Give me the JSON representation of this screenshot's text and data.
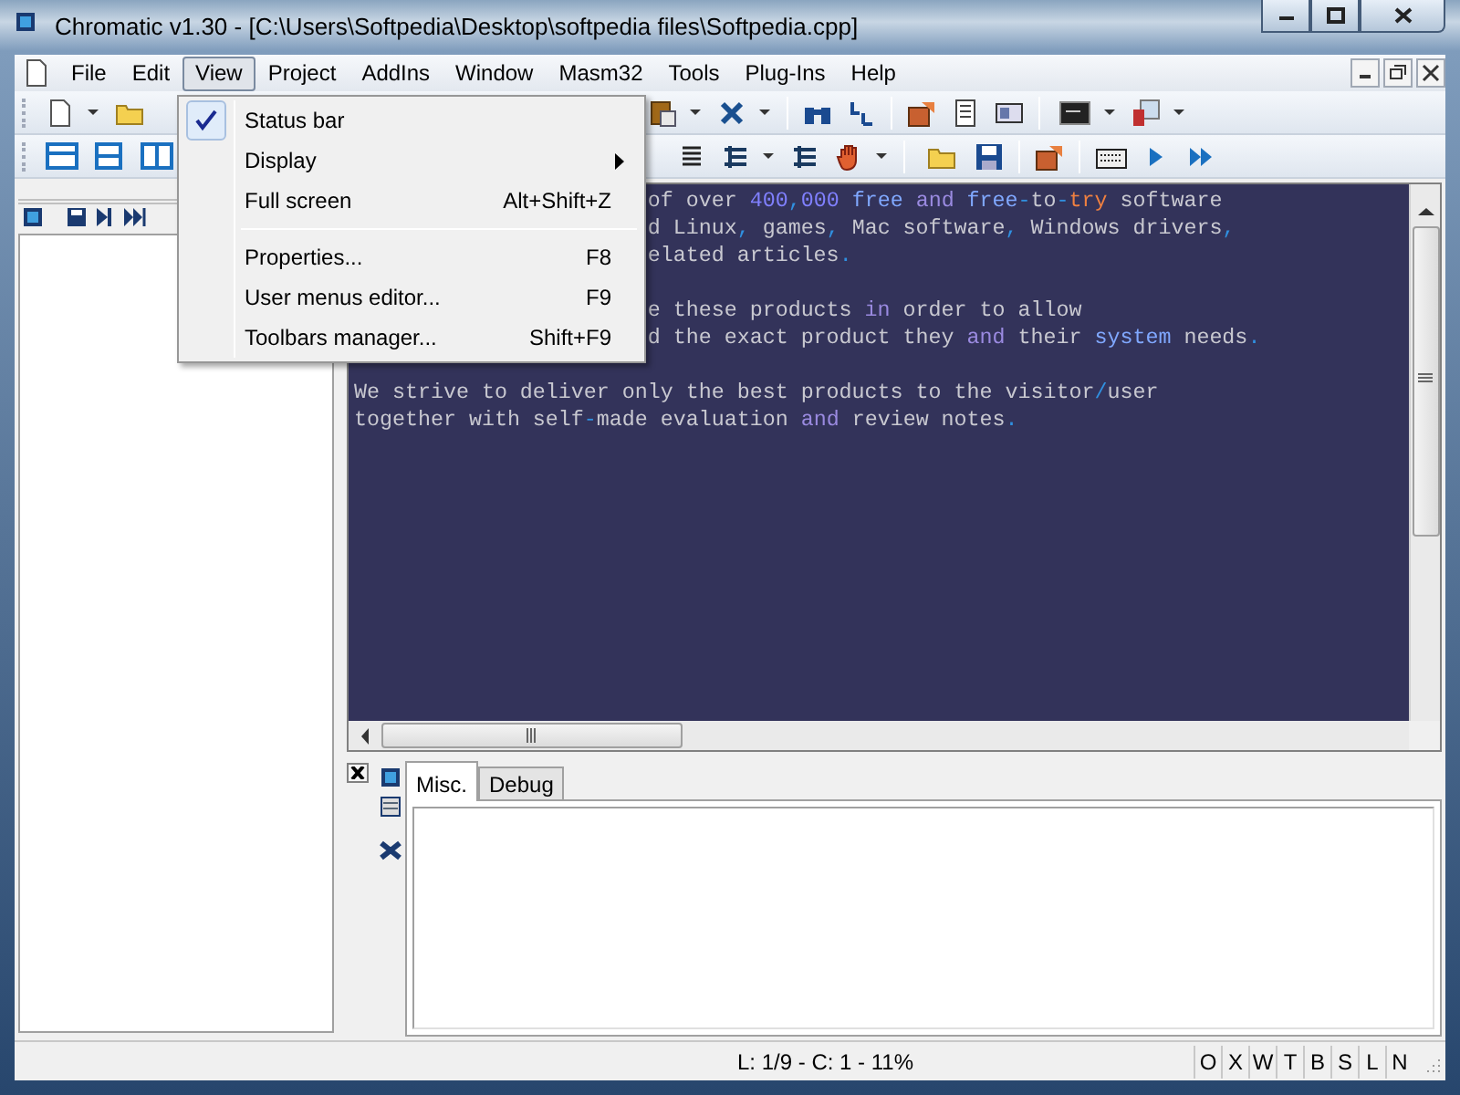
{
  "window": {
    "title": "Chromatic v1.30 - [C:\\Users\\Softpedia\\Desktop\\softpedia files\\Softpedia.cpp]"
  },
  "menu_bar": [
    {
      "label": "File",
      "selected": false
    },
    {
      "label": "Edit",
      "selected": false
    },
    {
      "label": "View",
      "selected": true
    },
    {
      "label": "Project",
      "selected": false
    },
    {
      "label": "AddIns",
      "selected": false
    },
    {
      "label": "Window",
      "selected": false
    },
    {
      "label": "Masm32",
      "selected": false
    },
    {
      "label": "Tools",
      "selected": false
    },
    {
      "label": "Plug-Ins",
      "selected": false
    },
    {
      "label": "Help",
      "selected": false
    }
  ],
  "view_menu": {
    "items": [
      {
        "kind": "item",
        "label": "Status bar",
        "checked": true
      },
      {
        "kind": "submenu",
        "label": "Display",
        "checked": false
      },
      {
        "kind": "item",
        "label": "Full screen",
        "shortcut": "Alt+Shift+Z",
        "checked": false
      },
      {
        "kind": "separator"
      },
      {
        "kind": "item",
        "label": "Properties...",
        "shortcut": "F8",
        "checked": false
      },
      {
        "kind": "item",
        "label": "User menus editor...",
        "shortcut": "F9",
        "checked": false
      },
      {
        "kind": "item",
        "label": "Toolbars manager...",
        "shortcut": "Shift+F9",
        "checked": false
      }
    ]
  },
  "editor": {
    "lines": [
      {
        "kind": "text",
        "covered": true,
        "tokens": [
          {
            "text": "of over ",
            "color": "#c8c8d0"
          },
          {
            "text": "400",
            "color": "#8080ff"
          },
          {
            "text": ",",
            "color": "#3090e0"
          },
          {
            "text": "000",
            "color": "#8080ff"
          },
          {
            "text": " free",
            "color": "#80a8ff"
          },
          {
            "text": " and",
            "color": "#9a8ae0"
          },
          {
            "text": " free",
            "color": "#80a8ff"
          },
          {
            "text": "-",
            "color": "#3090e0"
          },
          {
            "text": "to",
            "color": "#c8c8d0"
          },
          {
            "text": "-",
            "color": "#3090e0"
          },
          {
            "text": "try",
            "color": "#f08040"
          },
          {
            "text": " software",
            "color": "#c8c8d0"
          }
        ]
      },
      {
        "kind": "text",
        "covered": true,
        "tokens": [
          {
            "text": "d Linux",
            "color": "#c8c8d0"
          },
          {
            "text": ",",
            "color": "#3090e0"
          },
          {
            "text": " games",
            "color": "#c8c8d0"
          },
          {
            "text": ",",
            "color": "#3090e0"
          },
          {
            "text": " Mac software",
            "color": "#c8c8d0"
          },
          {
            "text": ",",
            "color": "#3090e0"
          },
          {
            "text": " Windows drivers",
            "color": "#c8c8d0"
          },
          {
            "text": ",",
            "color": "#3090e0"
          }
        ]
      },
      {
        "kind": "text",
        "covered": true,
        "tokens": [
          {
            "text": "elated articles",
            "color": "#c8c8d0"
          },
          {
            "text": ".",
            "color": "#3090e0"
          }
        ]
      },
      {
        "kind": "blank"
      },
      {
        "kind": "text",
        "covered": true,
        "tokens": [
          {
            "text": "e these products ",
            "color": "#c8c8d0"
          },
          {
            "text": "in",
            "color": "#9a8ae0"
          },
          {
            "text": " order to allow",
            "color": "#c8c8d0"
          }
        ]
      },
      {
        "kind": "text",
        "covered": true,
        "tokens": [
          {
            "text": "d the exact product they ",
            "color": "#c8c8d0"
          },
          {
            "text": "and",
            "color": "#9a8ae0"
          },
          {
            "text": " their ",
            "color": "#c8c8d0"
          },
          {
            "text": "system",
            "color": "#80a8ff"
          },
          {
            "text": " needs",
            "color": "#c8c8d0"
          },
          {
            "text": ".",
            "color": "#3090e0"
          }
        ]
      },
      {
        "kind": "blank"
      },
      {
        "kind": "text",
        "covered": false,
        "tokens": [
          {
            "text": "We strive to deliver only the best products to the visitor",
            "color": "#c8c8d0"
          },
          {
            "text": "/",
            "color": "#3090e0"
          },
          {
            "text": "user",
            "color": "#c8c8d0"
          }
        ]
      },
      {
        "kind": "text",
        "covered": false,
        "tokens": [
          {
            "text": "together with self",
            "color": "#c8c8d0"
          },
          {
            "text": "-",
            "color": "#3090e0"
          },
          {
            "text": "made evaluation ",
            "color": "#c8c8d0"
          },
          {
            "text": "and",
            "color": "#9a8ae0"
          },
          {
            "text": " review notes",
            "color": "#c8c8d0"
          },
          {
            "text": ".",
            "color": "#3090e0"
          }
        ]
      }
    ]
  },
  "bottom_panel": {
    "tabs": [
      {
        "label": "Misc.",
        "selected": true
      },
      {
        "label": "Debug",
        "selected": false
      }
    ]
  },
  "status_bar": {
    "position": "L: 1/9 - C: 1 - 11%",
    "indicators": [
      "O",
      "X",
      "W",
      "T",
      "B",
      "S",
      "L",
      "N"
    ]
  }
}
